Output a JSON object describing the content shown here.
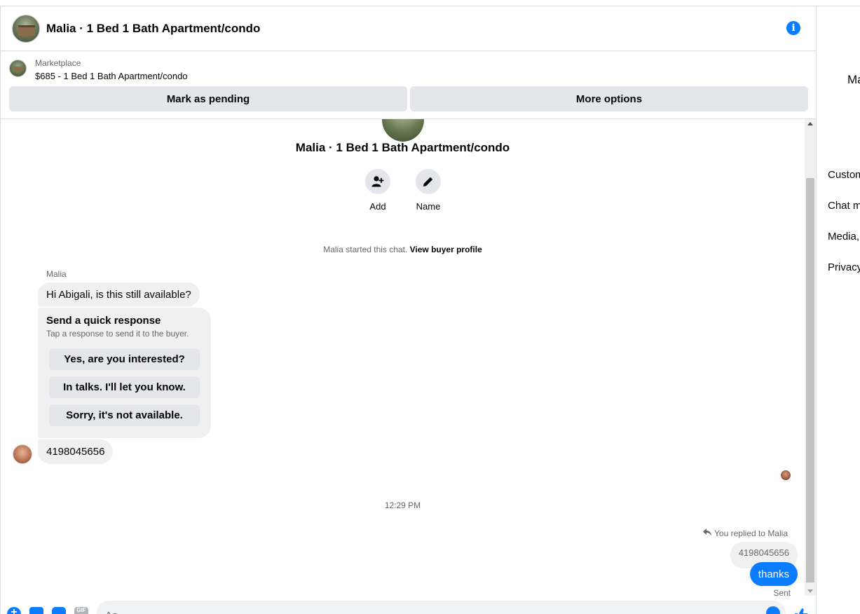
{
  "header": {
    "title": "Malia · 1 Bed 1 Bath Apartment/condo",
    "info_icon": "info-icon"
  },
  "listing": {
    "source": "Marketplace",
    "price_title": "$685 - 1 Bed 1 Bath Apartment/condo",
    "mark_pending_label": "Mark as pending",
    "more_options_label": "More options"
  },
  "conversation": {
    "title": "Malia · 1 Bed 1 Bath Apartment/condo",
    "actions": [
      {
        "label": "Add",
        "icon": "add-person-icon"
      },
      {
        "label": "Name",
        "icon": "pencil-icon"
      }
    ],
    "started_text": "Malia started this chat.",
    "view_profile_link": "View buyer profile"
  },
  "messages": {
    "sender_name": "Malia",
    "incoming_1": "Hi Abigali, is this still available?",
    "quick_response": {
      "title": "Send a quick response",
      "subtitle": "Tap a response to send it to the buyer.",
      "options": [
        "Yes, are you interested?",
        "In talks. I'll let you know.",
        "Sorry, it's not available."
      ]
    },
    "incoming_2": "4198045656",
    "timestamp": "12:29 PM",
    "replied_to": "You replied to Malia",
    "quoted_text": "4198045656",
    "outgoing": "thanks",
    "status": "Sent"
  },
  "composer": {
    "placeholder": "Aa",
    "icons": [
      "plus-icon",
      "photo-icon",
      "sticker-icon",
      "gif-icon",
      "emoji-icon",
      "thumbs-up-icon"
    ],
    "gif_label": "GIF"
  },
  "side_panel": {
    "name": "Ma",
    "items": [
      "Custom",
      "Chat m",
      "Media,",
      "Privacy"
    ]
  },
  "colors": {
    "accent": "#0a7cff",
    "bubble_in": "#f0f0f0",
    "button_gray": "#e4e6eb",
    "secondary_text": "#65676b"
  }
}
